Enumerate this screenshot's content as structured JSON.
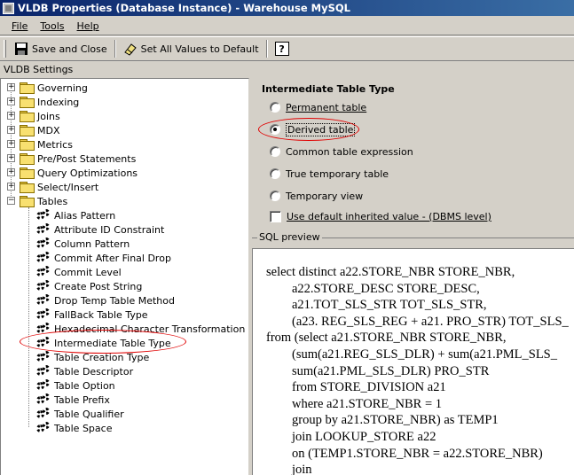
{
  "window": {
    "title": "VLDB Properties (Database Instance) - Warehouse MySQL"
  },
  "menu": {
    "file": "File",
    "tools": "Tools",
    "help": "Help"
  },
  "toolbar": {
    "save_close": "Save and Close",
    "set_default": "Set All Values to Default",
    "help_glyph": "?"
  },
  "settings_label": "VLDB Settings",
  "tree": {
    "folders": [
      "Governing",
      "Indexing",
      "Joins",
      "MDX",
      "Metrics",
      "Pre/Post Statements",
      "Query Optimizations",
      "Select/Insert",
      "Tables"
    ],
    "table_items": [
      "Alias Pattern",
      "Attribute ID Constraint",
      "Column Pattern",
      "Commit After Final Drop",
      "Commit Level",
      "Create Post String",
      "Drop Temp Table Method",
      "FallBack Table Type",
      "Hexadecimal Character Transformation",
      "Intermediate Table Type",
      "Table Creation Type",
      "Table Descriptor",
      "Table Option",
      "Table Prefix",
      "Table Qualifier",
      "Table Space"
    ],
    "selected": "Intermediate Table Type"
  },
  "panel": {
    "title": "Intermediate Table Type",
    "options": [
      "Permanent table",
      "Derived table",
      "Common table expression",
      "True temporary table",
      "Temporary view"
    ],
    "selected_option": "Derived table",
    "checkbox_label": "Use default inherited value - (DBMS level)",
    "checkbox_checked": false
  },
  "sql_preview": {
    "label": "SQL preview",
    "lines": [
      "select distinct a22.STORE_NBR STORE_NBR,",
      "        a22.STORE_DESC STORE_DESC,",
      "        a21.TOT_SLS_STR TOT_SLS_STR,",
      "        (a23. REG_SLS_REG + a21. PRO_STR) TOT_SLS_",
      "from (select a21.STORE_NBR STORE_NBR,",
      "        (sum(a21.REG_SLS_DLR) + sum(a21.PML_SLS_",
      "        sum(a21.PML_SLS_DLR) PRO_STR",
      "        from STORE_DIVISION a21",
      "        where a21.STORE_NBR = 1",
      "        group by a21.STORE_NBR) as TEMP1",
      "        join LOOKUP_STORE a22",
      "        on (TEMP1.STORE_NBR = a22.STORE_NBR)",
      "        join"
    ]
  }
}
